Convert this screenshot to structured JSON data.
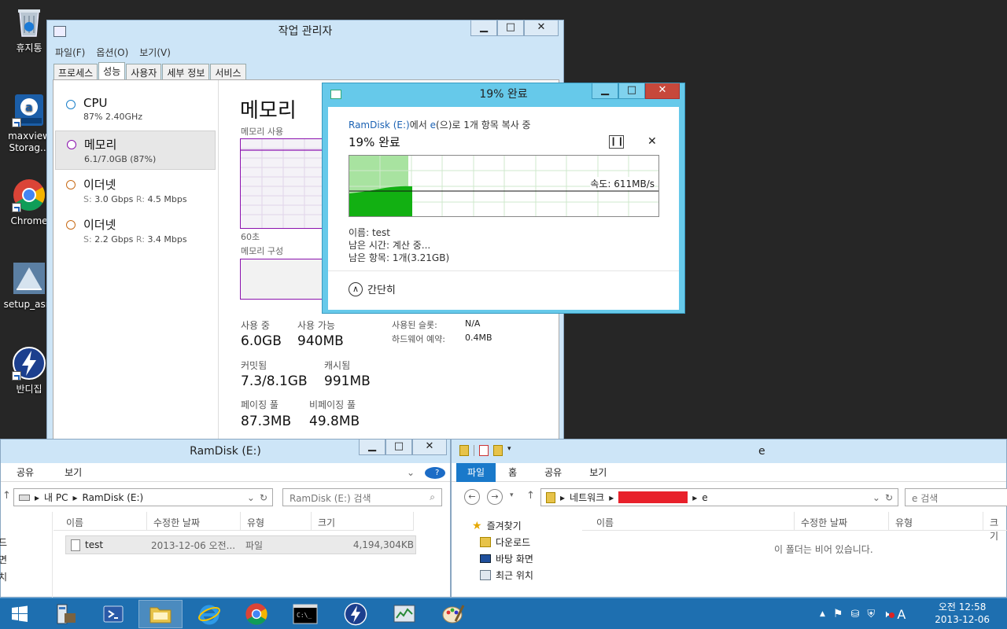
{
  "desktop": {
    "icons": [
      {
        "label": "휴지통"
      },
      {
        "label": "maxview Storag..."
      },
      {
        "label": "Chrome"
      },
      {
        "label": "setup_asm"
      },
      {
        "label": "반디집"
      }
    ]
  },
  "task_manager": {
    "title": "작업 관리자",
    "menu": [
      "파일(F)",
      "옵션(O)",
      "보기(V)"
    ],
    "tabs": [
      "프로세스",
      "성능",
      "사용자",
      "세부 정보",
      "서비스"
    ],
    "sidebar": [
      {
        "name": "CPU",
        "sub": "87% 2.40GHz",
        "color": "#1a7fc9"
      },
      {
        "name": "메모리",
        "sub": "6.1/7.0GB (87%)",
        "color": "#8b12ae"
      },
      {
        "name": "이더넷",
        "s_label": "S:",
        "s_val": "3.0 Gbps",
        "r_label": "R:",
        "r_val": "4.5 Mbps",
        "color": "#c86b17"
      },
      {
        "name": "이더넷",
        "s_label": "S:",
        "s_val": "2.2 Gbps",
        "r_label": "R:",
        "r_val": "3.4 Mbps",
        "color": "#c86b17"
      }
    ],
    "memory_title": "메모리",
    "usage_label": "메모리 사용",
    "time_label": "60초",
    "composition_label": "메모리 구성",
    "stats": {
      "in_use_label": "사용 중",
      "in_use": "6.0GB",
      "available_label": "사용 가능",
      "available": "940MB",
      "slots_label": "사용된 슬롯:",
      "slots": "N/A",
      "reserved_label": "하드웨어 예약:",
      "reserved": "0.4MB",
      "committed_label": "커밋됨",
      "committed": "7.3/8.1GB",
      "cached_label": "캐시됨",
      "cached": "991MB",
      "paged_label": "페이징 풀",
      "paged": "87.3MB",
      "nonpaged_label": "비페이징 풀",
      "nonpaged": "49.8MB"
    }
  },
  "copy_dialog": {
    "title": "19% 완료",
    "source": "RamDisk (E:)",
    "from_suffix": "에서",
    "dest": "e",
    "to_suffix": "(으)로 1개 항목 복사 중",
    "percent_text": "19% 완료",
    "speed": "속도: 611MB/s",
    "progress": 0.19,
    "name": "이름: test",
    "remaining_time": "남은 시간: 계산 중...",
    "remaining_items": "남은 항목: 1개(3.21GB)",
    "collapse_label": "간단히"
  },
  "explorer_left": {
    "title": "RamDisk (E:)",
    "ribbon": [
      "공유",
      "보기"
    ],
    "address": [
      "내 PC",
      "RamDisk (E:)"
    ],
    "search_placeholder": "RamDisk (E:) 검색",
    "columns": [
      "이름",
      "수정한 날짜",
      "유형",
      "크기"
    ],
    "rows": [
      {
        "name": "test",
        "date": "2013-12-06 오전...",
        "type": "파일",
        "size": "4,194,304KB"
      }
    ],
    "nav_partial": [
      "드",
      "면",
      "치"
    ]
  },
  "explorer_right": {
    "title": "e",
    "ribbon": [
      "파일",
      "홈",
      "공유",
      "보기"
    ],
    "address": [
      "네트워크",
      "e"
    ],
    "search_placeholder": "e 검색",
    "columns": [
      "이름",
      "수정한 날짜",
      "유형",
      "크기"
    ],
    "empty_message": "이 폴더는 비어 있습니다.",
    "nav": [
      "즐겨찾기",
      "다운로드",
      "바탕 화면",
      "최근 위치"
    ]
  },
  "taskbar": {
    "time": "오전 12:58",
    "date": "2013-12-06",
    "ime": "A"
  }
}
